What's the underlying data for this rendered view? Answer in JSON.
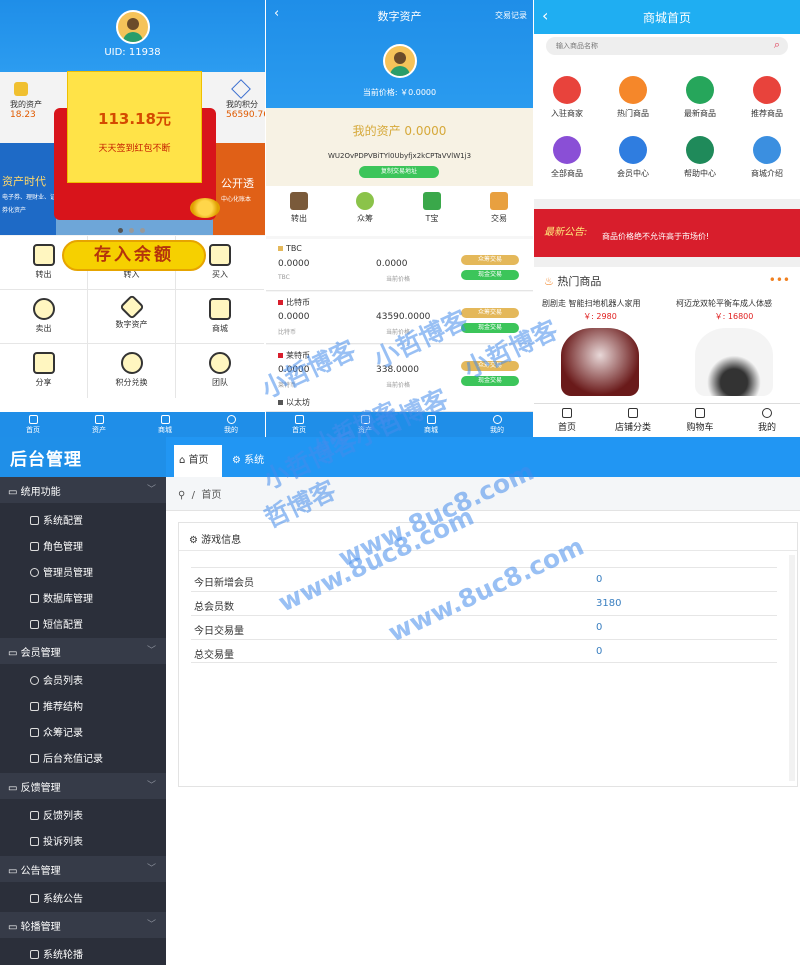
{
  "panel1": {
    "uid": "UID: 11938",
    "stat_left_label": "我的资产",
    "stat_left_value": "18.23",
    "stat_right_label": "我的积分",
    "stat_right_value": "56590.76",
    "banner_left": "资产时代",
    "banner_left_small": "电子券、理财业、证券化资产",
    "banner_right": "公开透",
    "banner_right_small": "中心化账本",
    "redpacket_amount": "113.18元",
    "redpacket_text": "天天签到红包不断",
    "deposit": "存入余额",
    "grid": [
      "转出",
      "转入",
      "买入",
      "卖出",
      "数字资产",
      "商城",
      "分享",
      "积分兑换",
      "团队"
    ],
    "tabs": [
      "首页",
      "资产",
      "商城",
      "我的"
    ]
  },
  "panel2": {
    "title": "数字资产",
    "records": "交易记录",
    "price": "当前价格: ￥0.0000",
    "my_asset": "我的资产  0.0000",
    "address": "WU2OvPDPVBiTYl0Ubyfjx2kCPTaVVlW1j3",
    "copy": "复制交易地址",
    "actions": [
      "转出",
      "众筹",
      "T宝",
      "交易"
    ],
    "coins": [
      {
        "name": "TBC",
        "v1": "0.0000",
        "v2": "0.0000",
        "s1": "TBC",
        "s2": "当前价格",
        "b1": "众筹交易",
        "b2": "现金交易"
      },
      {
        "name": "比特币",
        "v1": "0.0000",
        "v2": "43590.0000",
        "s1": "比特币",
        "s2": "当前价格",
        "b1": "众筹交易",
        "b2": "现金交易"
      },
      {
        "name": "莱特币",
        "v1": "0.0000",
        "v2": "338.0000",
        "s1": "莱特币",
        "s2": "当前价格",
        "b1": "众筹交易",
        "b2": "现金交易"
      },
      {
        "name": "以太坊",
        "v1": "",
        "v2": "",
        "s1": "",
        "s2": "",
        "b1": "",
        "b2": ""
      }
    ],
    "tabs": [
      "首页",
      "资产",
      "商城",
      "我的"
    ]
  },
  "panel3": {
    "title": "商城首页",
    "search_placeholder": "输入商品名称",
    "menu": [
      "入驻商家",
      "热门商品",
      "最新商品",
      "推荐商品",
      "全部商品",
      "会员中心",
      "帮助中心",
      "商城介绍"
    ],
    "menu_colors": [
      "#e8433c",
      "#f5872a",
      "#26a65b",
      "#e8433c",
      "#8a4fd6",
      "#2f7de0",
      "#1f8a5a",
      "#3b8fe0"
    ],
    "notice_label": "最新公告:",
    "notice_text": "商品价格绝不允许高于市场价!",
    "hot_title": "热门商品",
    "products": [
      {
        "name": "剧剧走 智能扫地机器人家用",
        "price": "￥: 2980"
      },
      {
        "name": "柯迈龙双轮平衡车成人体感",
        "price": "￥: 16800"
      }
    ],
    "tabs": [
      "首页",
      "店铺分类",
      "购物车",
      "我的"
    ]
  },
  "admin": {
    "brand": "后台管理",
    "tab_home": "首页",
    "tab_sys": "系统",
    "breadcrumb": "首页",
    "panel_title": "游戏信息",
    "rows": [
      {
        "k": "今日新增会员",
        "v": "0"
      },
      {
        "k": "总会员数",
        "v": "3180"
      },
      {
        "k": "今日交易量",
        "v": "0"
      },
      {
        "k": "总交易量",
        "v": "0"
      }
    ],
    "groups": [
      {
        "label": "统用功能",
        "items": [
          "系统配置",
          "角色管理",
          "管理员管理",
          "数据库管理",
          "短信配置"
        ]
      },
      {
        "label": "会员管理",
        "items": [
          "会员列表",
          "推荐结构",
          "众筹记录",
          "后台充值记录"
        ]
      },
      {
        "label": "反馈管理",
        "items": [
          "反馈列表",
          "投诉列表"
        ]
      },
      {
        "label": "公告管理",
        "items": [
          "系统公告"
        ]
      },
      {
        "label": "轮播管理",
        "items": [
          "系统轮播"
        ]
      }
    ]
  },
  "watermarks": [
    "小哲博客",
    "小哲博客",
    "小哲博客",
    "小哲博客",
    "www.8uc8.com",
    "www.8uc8.com",
    "www.8uc8.com",
    "小哲博客小哲博客",
    "哲博客"
  ]
}
